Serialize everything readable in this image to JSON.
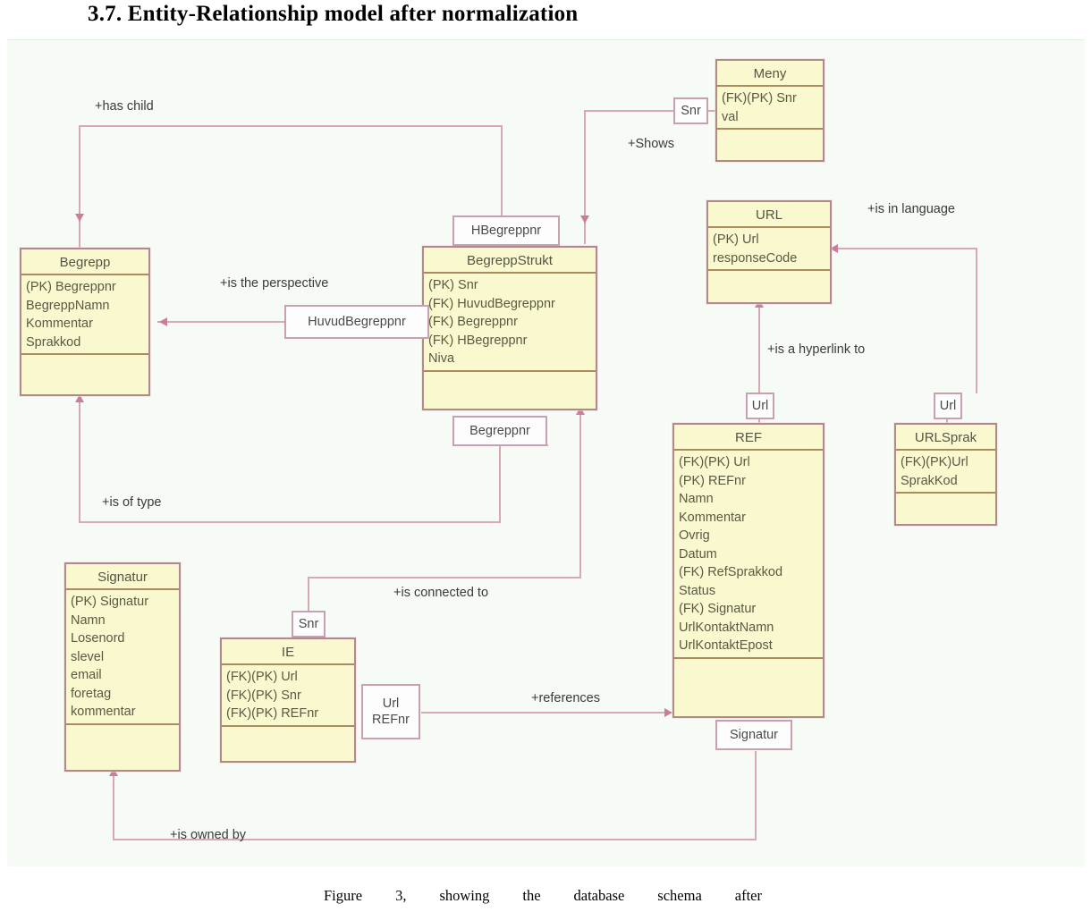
{
  "heading": "3.7. Entity-Relationship model after normalization",
  "caption": "Figure 3, showing the database schema after",
  "colors": {
    "entity_fill": "#f9f8cf",
    "entity_border": "#b08a8a",
    "header_rule": "#ab8a5f",
    "connector": "#d8a8b8",
    "canvas": "#f6fbf6"
  },
  "entities": [
    {
      "id": "meny",
      "name": "Meny",
      "attributes": [
        "(FK)(PK) Snr",
        "val"
      ]
    },
    {
      "id": "url",
      "name": "URL",
      "attributes": [
        "(PK) Url",
        "responseCode"
      ]
    },
    {
      "id": "begrepp",
      "name": "Begrepp",
      "attributes": [
        "(PK) Begreppnr",
        "BegreppNamn",
        "Kommentar",
        "Sprakkod"
      ]
    },
    {
      "id": "begreppstrukt",
      "name": "BegreppStrukt",
      "attributes": [
        "(PK) Snr",
        "(FK) HuvudBegreppnr",
        "(FK) Begreppnr",
        "(FK) HBegreppnr",
        "Niva"
      ]
    },
    {
      "id": "ref",
      "name": "REF",
      "attributes": [
        "(FK)(PK) Url",
        "(PK) REFnr",
        "Namn",
        "Kommentar",
        "Ovrig",
        "Datum",
        "(FK) RefSprakkod",
        "Status",
        "(FK) Signatur",
        "UrlKontaktNamn",
        "UrlKontaktEpost"
      ]
    },
    {
      "id": "urlsprak",
      "name": "URLSprak",
      "attributes": [
        "(FK)(PK)Url",
        "SprakKod"
      ]
    },
    {
      "id": "signatur",
      "name": "Signatur",
      "attributes": [
        "(PK) Signatur",
        "Namn",
        "Losenord",
        "slevel",
        "email",
        "foretag",
        "kommentar"
      ]
    },
    {
      "id": "ie",
      "name": "IE",
      "attributes": [
        "(FK)(PK) Url",
        "(FK)(PK) Snr",
        "(FK)(PK) REFnr"
      ]
    }
  ],
  "relationships": [
    {
      "id": "has-child",
      "label": "+has child"
    },
    {
      "id": "shows",
      "label": "+Shows"
    },
    {
      "id": "perspective",
      "label": "+is the perspective"
    },
    {
      "id": "in-language",
      "label": "+is in language"
    },
    {
      "id": "hyperlink-to",
      "label": "+is a hyperlink to"
    },
    {
      "id": "is-of-type",
      "label": "+is of type"
    },
    {
      "id": "connected-to",
      "label": "+is connected to"
    },
    {
      "id": "references",
      "label": "+references"
    },
    {
      "id": "owned-by",
      "label": "+is owned by"
    }
  ],
  "line_labels": [
    {
      "id": "snr-meny",
      "lines": [
        "Snr"
      ]
    },
    {
      "id": "hbegreppnr",
      "lines": [
        "HBegreppnr"
      ]
    },
    {
      "id": "huvudbegreppnr",
      "lines": [
        "HuvudBegreppnr"
      ]
    },
    {
      "id": "begreppnr",
      "lines": [
        "Begreppnr"
      ]
    },
    {
      "id": "url-ref",
      "lines": [
        "Url"
      ]
    },
    {
      "id": "url-urlsprak",
      "lines": [
        "Url"
      ]
    },
    {
      "id": "snr-ie",
      "lines": [
        "Snr"
      ]
    },
    {
      "id": "url-refnr",
      "lines": [
        "Url",
        "REFnr"
      ]
    },
    {
      "id": "signatur-ref",
      "lines": [
        "Signatur"
      ]
    }
  ]
}
